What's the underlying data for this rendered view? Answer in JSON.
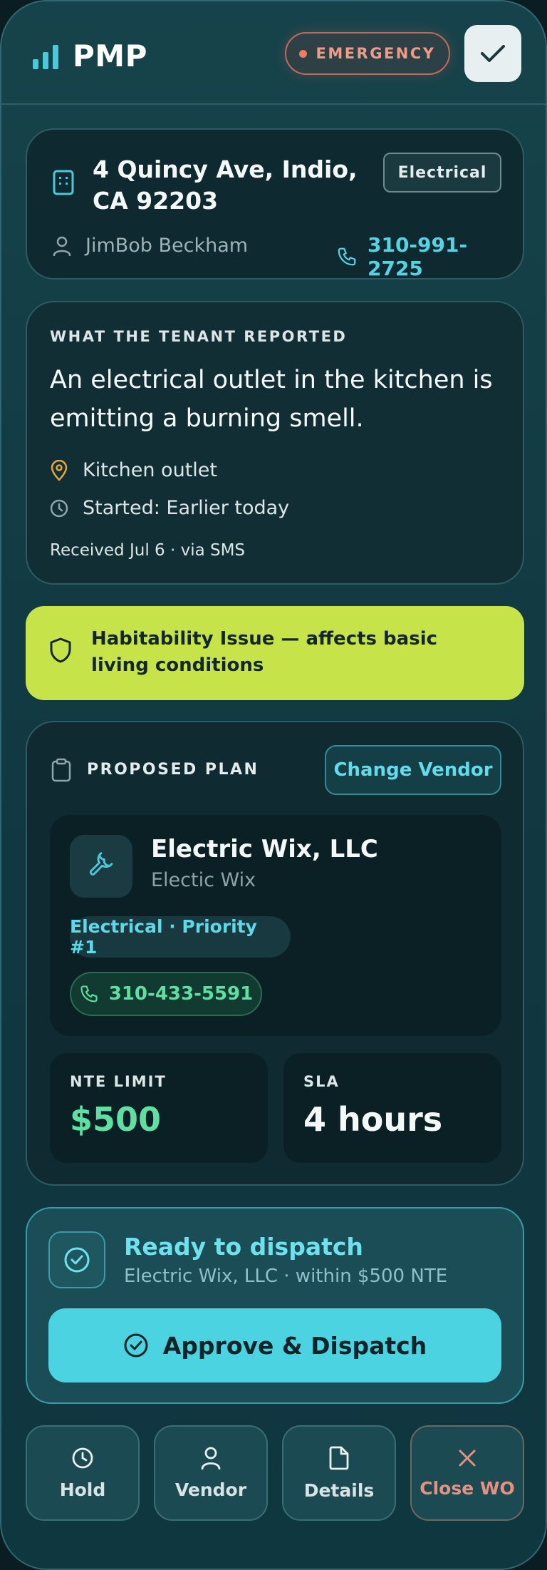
{
  "header": {
    "app_name": "PMP",
    "emergency_label": "EMERGENCY"
  },
  "property": {
    "address": "4 Quincy Ave, Indio, CA 92203",
    "category_tag": "Electrical",
    "tenant_name": "JimBob Beckham",
    "tenant_phone": "310-991-2725"
  },
  "report": {
    "eyebrow": "WHAT THE TENANT REPORTED",
    "description": "An electrical outlet in the kitchen is emitting a burning smell.",
    "location": "Kitchen outlet",
    "started": "Started: Earlier today",
    "received": "Received Jul 6 · via SMS"
  },
  "habitability": {
    "text": "Habitability Issue — affects basic living conditions"
  },
  "plan": {
    "label": "PROPOSED PLAN",
    "change_vendor_label": "Change Vendor",
    "vendor": {
      "name": "Electric Wix, LLC",
      "subtitle": "Electic Wix",
      "category": "Electrical · Priority #1",
      "phone": "310-433-5591"
    },
    "nte": {
      "label": "NTE LIMIT",
      "value": "$500"
    },
    "sla": {
      "label": "SLA",
      "value": "4 hours"
    }
  },
  "dispatch": {
    "title": "Ready to dispatch",
    "subtitle": "Electric Wix, LLC · within $500 NTE",
    "button_label": "Approve & Dispatch"
  },
  "actions": [
    {
      "label": "Hold",
      "icon": "clock-icon"
    },
    {
      "label": "Vendor",
      "icon": "person-icon"
    },
    {
      "label": "Details",
      "icon": "document-icon"
    },
    {
      "label": "Close WO",
      "icon": "close-icon"
    }
  ],
  "colors": {
    "accent": "#4cd3e2",
    "emergency": "#ef7b63",
    "habitability": "#c6e44a",
    "money": "#5fe0a2"
  }
}
